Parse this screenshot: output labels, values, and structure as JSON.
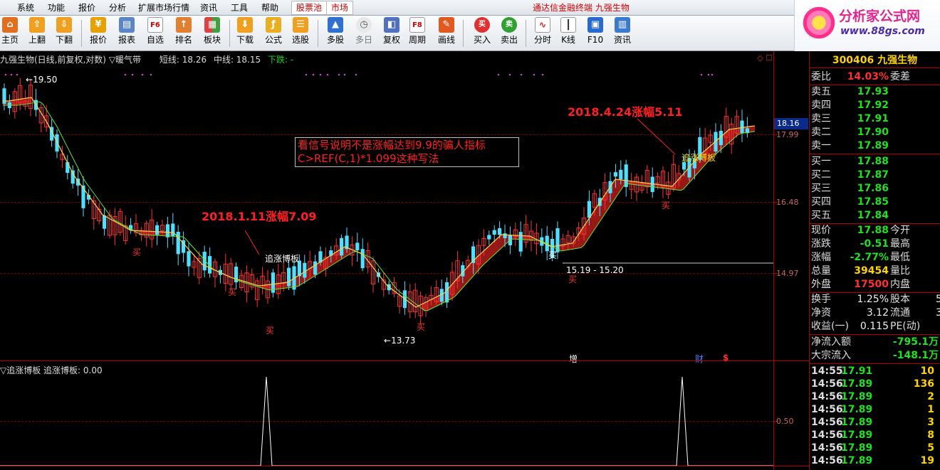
{
  "menubar": {
    "items": [
      "系统",
      "功能",
      "报价",
      "分析",
      "扩展市场行情",
      "资讯",
      "工具",
      "帮助"
    ],
    "tab_stockpool": "股票池",
    "tab_market": "市场",
    "title": "通达信金融终端  九强生物"
  },
  "toolbar": {
    "buttons": [
      "主页",
      "上翻",
      "下翻",
      "报价",
      "报表",
      "自选",
      "排名",
      "板块",
      "下载",
      "公式",
      "选股",
      "多股",
      "多日",
      "复权",
      "周期",
      "画线",
      "买入",
      "卖出",
      "分时",
      "K线",
      "F10",
      "资讯"
    ]
  },
  "brand": {
    "title": "分析家公式网",
    "url": "www.88gs.com"
  },
  "chart": {
    "stock_label": "九强生物(日线,前复权,对数)",
    "indicator_label": "▽暖气带",
    "short_label": "短线: 18.26",
    "mid_label": "中线: 18.15",
    "down_label": "下跌: -",
    "axis_labels": [
      "17.99",
      "16.48",
      "14.97",
      "0.50"
    ],
    "current_price": "18.16",
    "high_label": "19.50",
    "low_label": "13.73",
    "range_label": "15.19 - 15.20",
    "annot_1_date": "2018.1.11涨幅7.09",
    "annot_2_date": "2018.4.24涨幅5.11",
    "signal_label": "追涨博板",
    "buy_label": "买",
    "note_line1": "看信号说明不是涨幅达到9.9的骗人指标",
    "note_line2": "C>REF(C,1)*1.099这种写法",
    "mark_zeng": "增",
    "mark_cai": "财",
    "mark_s": "$",
    "sub_header": "▽追涨博板  追涨博板: 0.00",
    "colors": {
      "up": "#50e0ff",
      "down": "#ff3232",
      "band": "#a01818",
      "line_short": "#ffd24a",
      "line_mid": "#64e632"
    }
  },
  "right_panel": {
    "title": "300406 九强生物",
    "weibi": {
      "label": "委比",
      "value": "14.03%",
      "label2": "委差"
    },
    "asks": [
      {
        "label": "卖五",
        "price": "17.93"
      },
      {
        "label": "卖四",
        "price": "17.92"
      },
      {
        "label": "卖三",
        "price": "17.91"
      },
      {
        "label": "卖二",
        "price": "17.90"
      },
      {
        "label": "卖一",
        "price": "17.89"
      }
    ],
    "bids": [
      {
        "label": "买一",
        "price": "17.88"
      },
      {
        "label": "买二",
        "price": "17.87"
      },
      {
        "label": "买三",
        "price": "17.86"
      },
      {
        "label": "买四",
        "price": "17.85"
      },
      {
        "label": "买五",
        "price": "17.84"
      }
    ],
    "stats": [
      {
        "label": "现价",
        "value": "17.88",
        "label2": "今开"
      },
      {
        "label": "涨跌",
        "value": "-0.51",
        "label2": "最高"
      },
      {
        "label": "涨幅",
        "value": "-2.77%",
        "label2": "最低"
      },
      {
        "label": "总量",
        "value": "39454",
        "label2": "量比"
      },
      {
        "label": "外盘",
        "value": "17500",
        "label2": "内盘"
      }
    ],
    "stats2": [
      {
        "label": "换手",
        "value": "1.25%",
        "label2": "股本",
        "extra": "5"
      },
      {
        "label": "净资",
        "value": "3.12",
        "label2": "流通",
        "extra": "3"
      },
      {
        "label": "收益(一)",
        "value": "0.115",
        "label2": "PE(动)",
        "extra": ""
      }
    ],
    "flows": [
      {
        "label": "净流入额",
        "value": "-795.1万"
      },
      {
        "label": "大宗流入",
        "value": "-148.1万"
      }
    ],
    "trades": [
      {
        "time": "14:55",
        "price": "17.91",
        "vol": "10"
      },
      {
        "time": "14:56",
        "price": "17.89",
        "vol": "136"
      },
      {
        "time": "14:56",
        "price": "17.89",
        "vol": "2"
      },
      {
        "time": "14:56",
        "price": "17.89",
        "vol": "1"
      },
      {
        "time": "14:56",
        "price": "17.89",
        "vol": "3"
      },
      {
        "time": "14:56",
        "price": "17.89",
        "vol": "8"
      },
      {
        "time": "14:56",
        "price": "17.89",
        "vol": "5"
      },
      {
        "time": "14:56",
        "price": "17.89",
        "vol": "19"
      }
    ]
  }
}
